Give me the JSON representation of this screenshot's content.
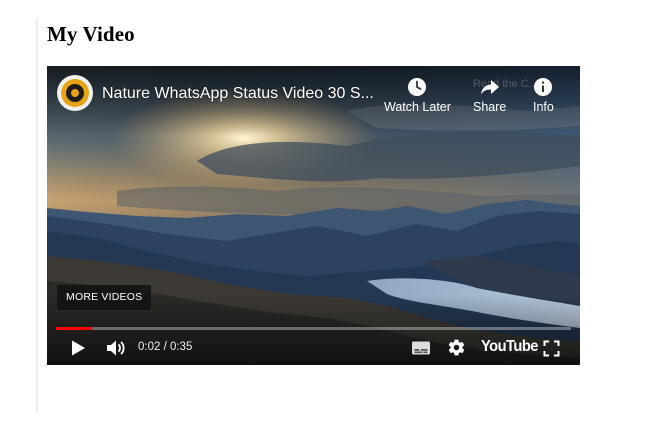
{
  "page": {
    "title": "My Video"
  },
  "player": {
    "video_title": "Nature WhatsApp Status Video 30 S...",
    "faded_overlay_text": "Read the C...",
    "top_actions": {
      "watch_later": "Watch Later",
      "share": "Share",
      "info": "Info"
    },
    "more_videos_label": "MORE VIDEOS",
    "time_display": "0:02 / 0:35",
    "progress_fraction": 0.07,
    "logo_text": "YouTube",
    "colors": {
      "progress": "#ff0000",
      "avatar_ring": "#e8a317",
      "avatar_center": "#1c1c1c"
    },
    "icons": {
      "watch_later": "clock-icon",
      "share": "share-arrow-icon",
      "info": "info-icon",
      "play": "play-icon",
      "volume": "volume-icon",
      "captions": "captions-icon",
      "settings": "gear-icon",
      "fullscreen": "fullscreen-icon"
    }
  }
}
